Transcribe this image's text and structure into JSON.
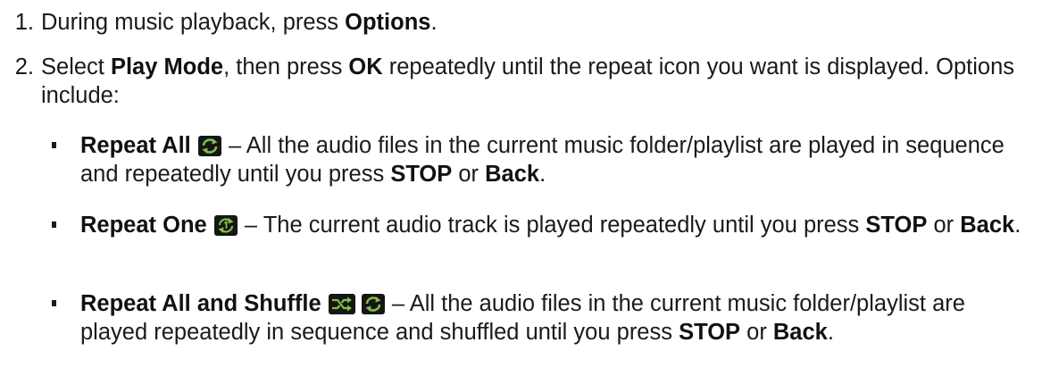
{
  "steps": [
    {
      "num": "1.",
      "prefix": "During music playback, press ",
      "bold": "Options",
      "suffix": "."
    },
    {
      "num": "2.",
      "prefix": "Select ",
      "bold1": "Play Mode",
      "middle": ", then press ",
      "bold2": "OK",
      "suffix": " repeatedly until the repeat icon you want is displayed. Options include:"
    }
  ],
  "options": [
    {
      "title": "Repeat All",
      "icon": "repeat-all-icon",
      "desc_prefix": " – All the audio files in the current music folder/playlist are played in sequence and repeatedly until you press ",
      "stop": "STOP",
      "or": " or ",
      "back": "Back",
      "end": "."
    },
    {
      "title": "Repeat One",
      "icon": "repeat-one-icon",
      "desc_prefix": " – The current audio track is played repeatedly until you press ",
      "stop": "STOP",
      "or": " or ",
      "back": "Back",
      "end": "."
    },
    {
      "title": "Repeat All and Shuffle",
      "icon": "shuffle-icon",
      "icon2": "repeat-all-icon",
      "desc_prefix": " – All the audio files in the current music folder/playlist are played repeatedly in sequence and shuffled until you press ",
      "stop": "STOP",
      "or": " or ",
      "back": "Back",
      "end": "."
    }
  ],
  "colors": {
    "text": "#1a1a1a",
    "icon_bg": "#161616",
    "icon_green": "#7fc24a"
  }
}
